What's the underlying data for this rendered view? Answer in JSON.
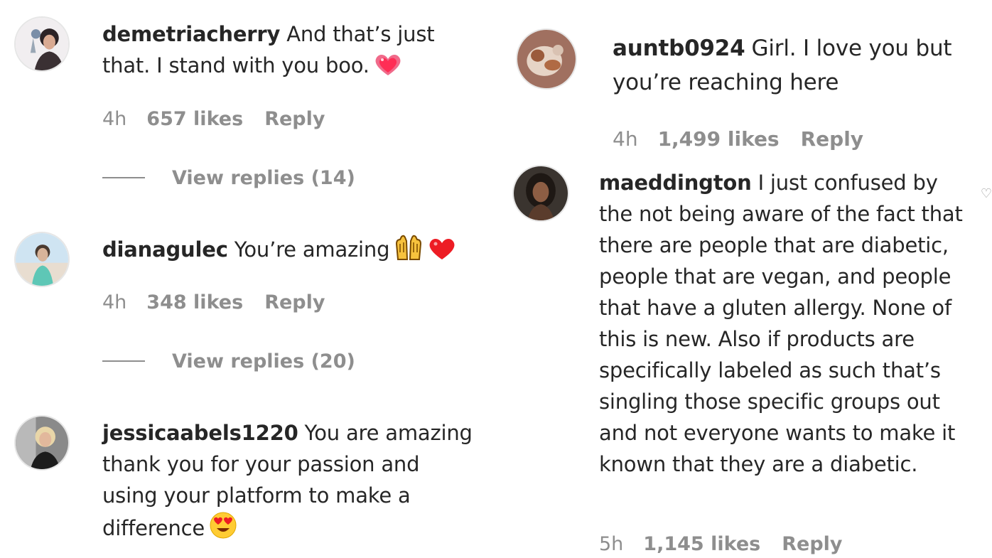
{
  "left_comments": [
    {
      "username": "demetriacherry",
      "text": "And that’s just that. I stand with you boo.",
      "emoji": "sparkling-heart",
      "time": "4h",
      "likes": "657 likes",
      "reply": "Reply",
      "view_replies": "View replies (14)"
    },
    {
      "username": "dianagulec",
      "text": "You’re amazing",
      "emoji": "raised-hands-and-heart",
      "time": "4h",
      "likes": "348 likes",
      "reply": "Reply",
      "view_replies": "View replies (20)"
    },
    {
      "username": "jessicaabels1220",
      "text": "You are amazing thank you for your passion and using your platform to make a difference",
      "emoji": "heart-eyes-face"
    }
  ],
  "right_comments": [
    {
      "username": "auntb0924",
      "text": "Girl. I love you but you’re reaching here",
      "time": "4h",
      "likes": "1,499 likes",
      "reply": "Reply"
    },
    {
      "username": "maeddington",
      "text": "I just confused by the not being aware of the fact that there are people that are diabetic, people that are vegan, and people that have a gluten allergy. None of this is new. Also if products are specifically labeled as such that’s singling those specific groups out and not everyone wants to make it known that they are a diabetic.",
      "time": "5h",
      "likes": "1,145 likes",
      "reply": "Reply"
    }
  ],
  "colors": {
    "text": "#262626",
    "secondary": "#8e8e8e",
    "heart_red": "#ed1c24",
    "avatar_border": "#e6e6e6"
  }
}
